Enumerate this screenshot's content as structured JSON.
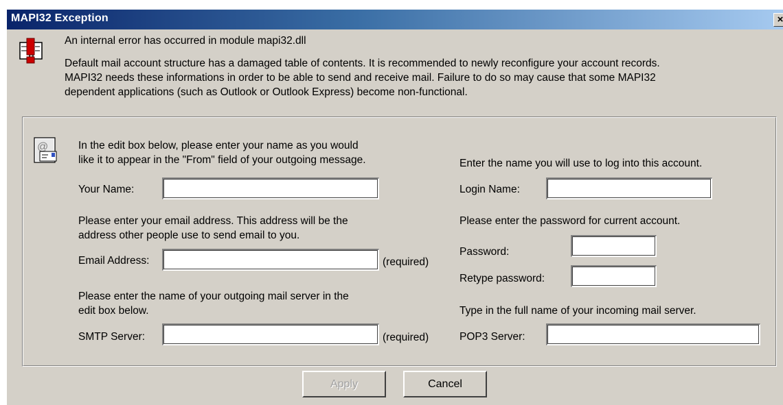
{
  "window": {
    "title": "MAPI32 Exception",
    "close_glyph": "×"
  },
  "error": {
    "icon": "warning-mail-icon",
    "headline": "An internal error has occurred in module mapi32.dll",
    "line1": "Default mail account structure has a damaged table of contents. It is recommended to newly reconfigure your account records.",
    "line2": "MAPI32 needs these informations in order to be able to send and receive mail. Failure to do so may cause that some MAPI32",
    "line3": "dependent applications (such as Outlook or Outlook Express) become non-functional."
  },
  "form": {
    "icon": "mail-at-icon",
    "left": {
      "name_help_1": "In the edit box below, please enter your name as you would",
      "name_help_2": "like it to appear in the \"From\" field of your outgoing message.",
      "name_label": "Your Name:",
      "name_value": "",
      "email_help_1": "Please enter your email address. This address will be the",
      "email_help_2": "address other people use to send email to you.",
      "email_label": "Email Address:",
      "email_value": "",
      "email_required": "(required)",
      "smtp_help_1": "Please enter the name of your outgoing mail server in the",
      "smtp_help_2": "edit box below.",
      "smtp_label": "SMTP Server:",
      "smtp_value": "",
      "smtp_required": "(required)"
    },
    "right": {
      "login_help": "Enter the name you will use to log into this account.",
      "login_label": "Login Name:",
      "login_value": "",
      "password_help": "Please enter the password for current account.",
      "password_label": "Password:",
      "password_value": "",
      "retype_label": "Retype password:",
      "retype_value": "",
      "pop3_help": "Type in the full name of your incoming mail server.",
      "pop3_label": "POP3 Server:",
      "pop3_value": ""
    }
  },
  "buttons": {
    "apply_label": "Apply",
    "cancel_label": "Cancel"
  },
  "colors": {
    "dialog_bg": "#d4d0c8",
    "titlebar_start": "#0a246a",
    "titlebar_end": "#a6caf0",
    "error_red": "#cc0000"
  }
}
